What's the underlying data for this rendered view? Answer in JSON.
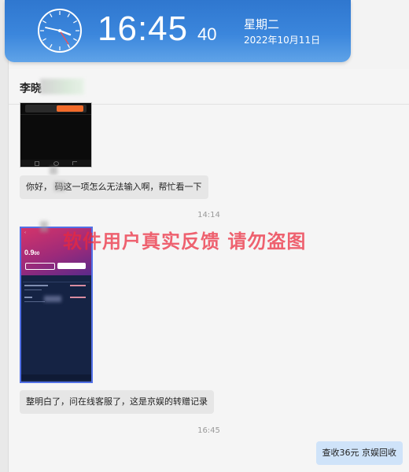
{
  "clock": {
    "time": "16:45",
    "seconds": "40",
    "weekday": "星期二",
    "date": "2022年10月11日"
  },
  "chat": {
    "contact_name": "李晓",
    "messages": [
      {
        "type": "text",
        "text": "你好，  码这一项怎么无法输入啊，帮忙看一下"
      },
      {
        "type": "time",
        "text": "14:14"
      },
      {
        "type": "text",
        "text": "整明白了，问在线客服了，这是京娱的转赠记录"
      },
      {
        "type": "time",
        "text": "16:45"
      },
      {
        "type": "text_out",
        "text": "查收36元  京娱回收"
      }
    ],
    "screenshot_2": {
      "balance": "0.9",
      "balance_suffix": "00"
    }
  },
  "watermark": "软件用户真实反馈  请勿盗图",
  "colors": {
    "clock_blue": "#3b86dc",
    "watermark_red": "#eb283c",
    "bubble_in": "#e6e6e6",
    "bubble_out": "#cfe3f9"
  }
}
